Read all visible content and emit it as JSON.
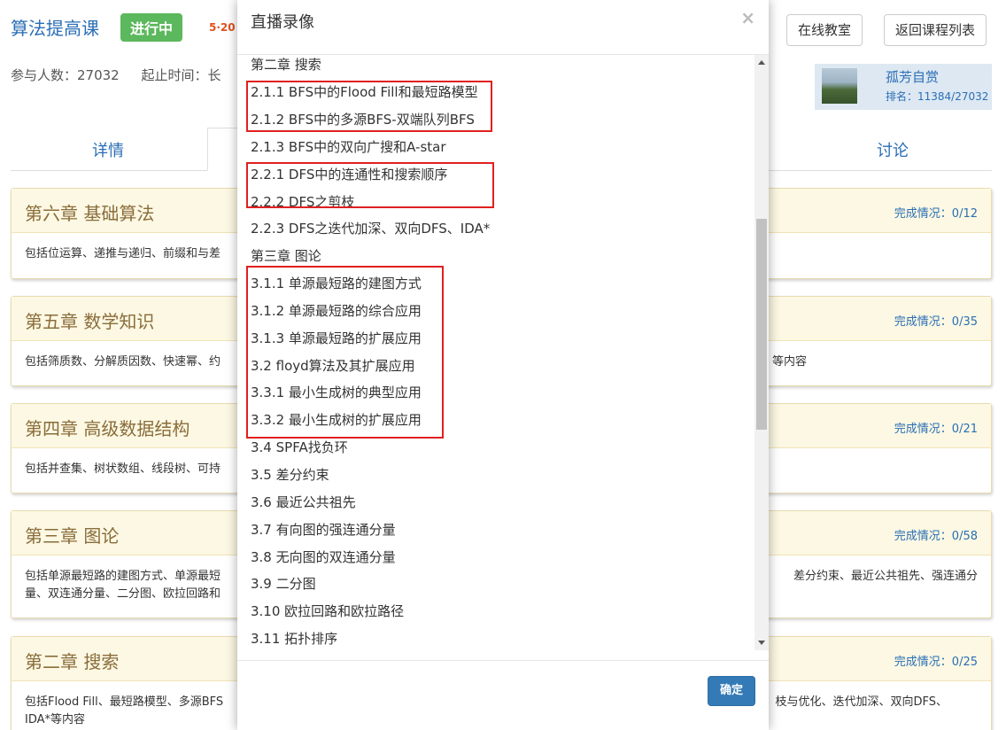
{
  "header": {
    "course_title": "算法提高课",
    "status": "进行中",
    "date_partial": "5·20",
    "btn_classroom": "在线教室",
    "btn_back": "返回课程列表",
    "participants": "参与人数：27032",
    "period": "起止时间：长"
  },
  "user": {
    "name": "孤芳自赏",
    "rank": "排名：11384/27032"
  },
  "tabs": {
    "detail": "详情",
    "discuss": "讨论"
  },
  "chapters": [
    {
      "title": "第六章 基础算法",
      "progress": "完成情况：0/12",
      "desc_left": "包括位运算、递推与递归、前缀和与差",
      "desc_right": ""
    },
    {
      "title": "第五章 数学知识",
      "progress": "完成情况：0/35",
      "desc_left": "包括筛质数、分解质因数、快速幂、约",
      "desc_right": "等内容"
    },
    {
      "title": "第四章 高级数据结构",
      "progress": "完成情况：0/21",
      "desc_left": "包括并查集、树状数组、线段树、可持",
      "desc_right": ""
    },
    {
      "title": "第三章 图论",
      "progress": "完成情况：0/58",
      "desc_left": "包括单源最短路的建图方式、单源最短",
      "desc_left2": "量、双连通分量、二分图、欧拉回路和",
      "desc_right": "差分约束、最近公共祖先、强连通分",
      "desc_right2": ""
    },
    {
      "title": "第二章 搜索",
      "progress": "完成情况：0/25",
      "desc_left": "包括Flood Fill、最短路模型、多源BFS",
      "desc_left2": "IDA*等内容",
      "desc_right": "枝与优化、迭代加深、双向DFS、",
      "desc_right2": ""
    }
  ],
  "modal": {
    "title": "直播录像",
    "close": "×",
    "ok": "确定",
    "items": [
      "第二章 搜索",
      "2.1.1 BFS中的Flood Fill和最短路模型",
      "2.1.2 BFS中的多源BFS-双端队列BFS",
      "2.1.3 BFS中的双向广搜和A-star",
      "2.2.1 DFS中的连通性和搜索顺序",
      "2.2.2 DFS之剪枝",
      "2.2.3 DFS之迭代加深、双向DFS、IDA*",
      "第三章 图论",
      "3.1.1 单源最短路的建图方式",
      "3.1.2 单源最短路的综合应用",
      "3.1.3 单源最短路的扩展应用",
      "3.2 floyd算法及其扩展应用",
      "3.3.1 最小生成树的典型应用",
      "3.3.2 最小生成树的扩展应用",
      "3.4 SPFA找负环",
      "3.5 差分约束",
      "3.6 最近公共祖先",
      "3.7 有向图的强连通分量",
      "3.8 无向图的双连通分量",
      "3.9 二分图",
      "3.10 欧拉回路和欧拉路径",
      "3.11 拓扑排序"
    ]
  },
  "colors": {
    "link_blue": "#2a6eb5",
    "badge_green": "#5cb85c",
    "chapter_head_bg": "#fcf8e3",
    "highlight_red": "#e02020",
    "primary_button": "#337ab7"
  }
}
